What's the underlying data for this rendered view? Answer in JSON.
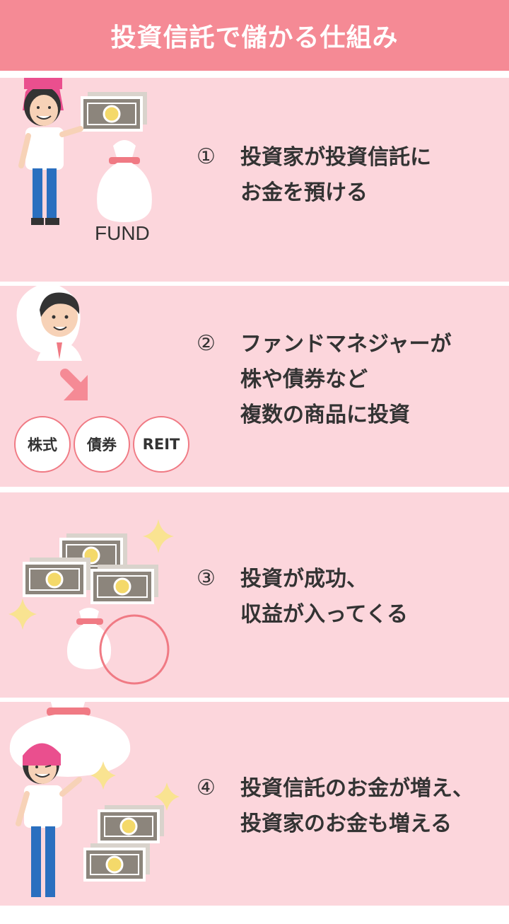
{
  "header": {
    "title": "投資信託で儲かる仕組み"
  },
  "steps": [
    {
      "number": "①",
      "lines": [
        "投資家が投資信託に",
        "お金を預ける"
      ]
    },
    {
      "number": "②",
      "lines": [
        "ファンドマネジャーが",
        "株や債券など",
        "複数の商品に投資"
      ]
    },
    {
      "number": "③",
      "lines": [
        "投資が成功、",
        "収益が入ってくる"
      ]
    },
    {
      "number": "④",
      "lines": [
        "投資信託のお金が増え、",
        "投資家のお金も増える"
      ]
    }
  ],
  "step1_illustration": {
    "fund_label": "FUND"
  },
  "step2_illustration": {
    "assets": [
      "株式",
      "債券",
      "REIT"
    ]
  },
  "colors": {
    "header_bg": "#f58a95",
    "panel_bg": "#fcd6dc",
    "accent_pink": "#f07a84",
    "hat_pink": "#ea4f8e",
    "bill_gray": "#8c857c",
    "coin_yellow": "#f4d96a"
  }
}
